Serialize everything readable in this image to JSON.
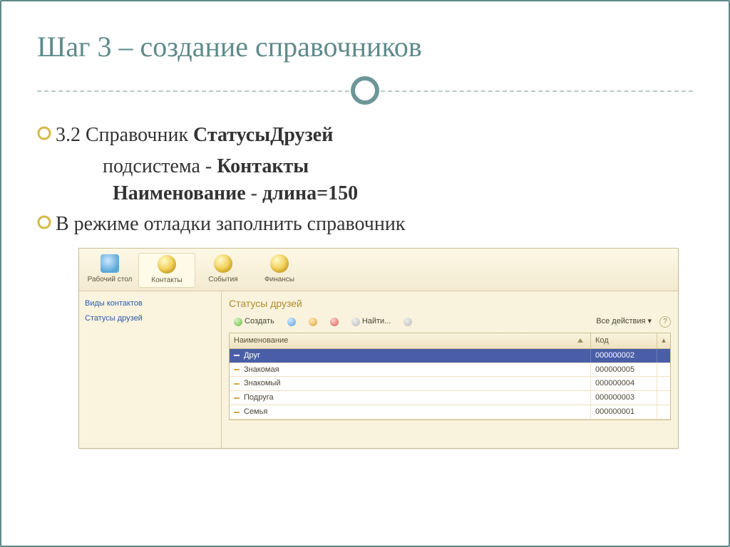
{
  "slide": {
    "title": "Шаг 3 – создание справочников",
    "bullet1_prefix": "3.2 Справочник  ",
    "bullet1_bold": "СтатусыДрузей",
    "line2_prefix": "подсистема -  ",
    "line2_bold": "Контакты",
    "line3_bold_a": "Наименование",
    "line3_mid": "  - ",
    "line3_bold_b": "длина=150",
    "bullet2": "В режиме отладки заполнить  справочник"
  },
  "app": {
    "topbar": [
      {
        "label": "Рабочий стол",
        "icon": "desk",
        "active": false
      },
      {
        "label": "Контакты",
        "icon": "sphere",
        "active": true
      },
      {
        "label": "События",
        "icon": "sphere",
        "active": false
      },
      {
        "label": "Финансы",
        "icon": "sphere",
        "active": false
      }
    ],
    "sidebar": [
      "Виды контактов",
      "Статусы друзей"
    ],
    "panel_title": "Статусы друзей",
    "toolbar": {
      "create": "Создать",
      "find": "Найти...",
      "all_actions": "Все действия"
    },
    "grid": {
      "header_name": "Наименование",
      "header_code": "Код",
      "rows": [
        {
          "name": "Друг",
          "code": "000000002",
          "selected": true
        },
        {
          "name": "Знакомая",
          "code": "000000005",
          "selected": false
        },
        {
          "name": "Знакомый",
          "code": "000000004",
          "selected": false
        },
        {
          "name": "Подруга",
          "code": "000000003",
          "selected": false
        },
        {
          "name": "Семья",
          "code": "000000001",
          "selected": false
        }
      ]
    }
  }
}
